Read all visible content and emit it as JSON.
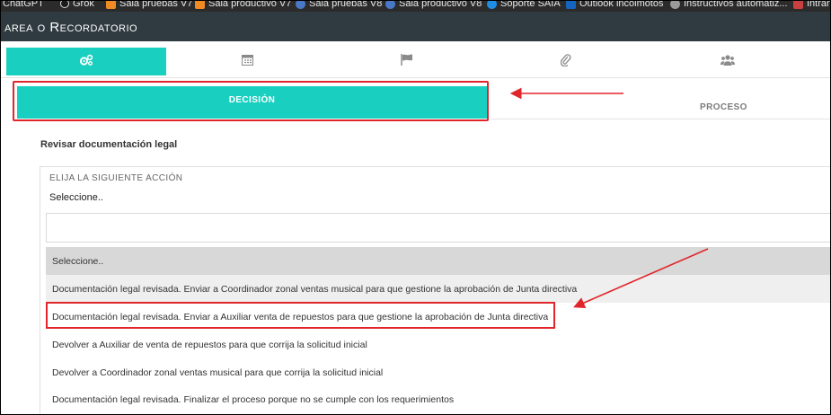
{
  "bookmarks": [
    {
      "label": "ChatGPT",
      "icon": "chatgpt-icon",
      "color": "#1b1b1b"
    },
    {
      "label": "Grok",
      "icon": "grok-icon",
      "color": "#1b1b1b"
    },
    {
      "label": "Sala pruebas V7",
      "icon": "sala-icon",
      "color": "#f08a24"
    },
    {
      "label": "Sala productivo V7",
      "icon": "sala-icon",
      "color": "#f08a24"
    },
    {
      "label": "Sala pruebas V8",
      "icon": "shield-icon",
      "color": "#4a78c9"
    },
    {
      "label": "Sala productivo V8",
      "icon": "shield-icon",
      "color": "#4a78c9"
    },
    {
      "label": "Soporte SAIA",
      "icon": "skype-icon",
      "color": "#1f8de6"
    },
    {
      "label": "Outlook incolmotos",
      "icon": "outlook-icon",
      "color": "#1565c0"
    },
    {
      "label": "Instructivos automatiz...",
      "icon": "wordpress-icon",
      "color": "#777777"
    },
    {
      "label": "Intran",
      "icon": "intranet-icon",
      "color": "#c94040"
    }
  ],
  "window": {
    "title": "area o Recordatorio"
  },
  "icon_tabs": [
    {
      "icon": "gears-icon",
      "glyph": "⚙",
      "active": true
    },
    {
      "icon": "calendar-icon",
      "glyph": "▦",
      "active": false
    },
    {
      "icon": "flag-icon",
      "glyph": "⚑",
      "active": false
    },
    {
      "icon": "paperclip-icon",
      "glyph": "✎",
      "active": false
    },
    {
      "icon": "users-icon",
      "glyph": "👥",
      "active": false
    }
  ],
  "sub_tabs": {
    "decision": "DECISIÓN",
    "proceso": "PROCESO"
  },
  "section_title": "Revisar documentación legal",
  "select": {
    "label": "ELIJA LA SIGUIENTE ACCIÓN",
    "value": "Seleccione..",
    "search_value": ""
  },
  "options": [
    "Seleccione..",
    "Documentación legal revisada. Enviar a Coordinador zonal ventas musical para que gestione la aprobación de Junta directiva",
    "Documentación legal revisada. Enviar a Auxiliar venta de repuestos para que gestione la aprobación de Junta directiva",
    "Devolver a Auxiliar de venta de repuestos para que corrija la solicitud inicial",
    "Devolver a Coordinador zonal ventas musical para que corrija la solicitud inicial",
    "Documentación legal revisada. Finalizar el proceso porque no se cumple con los requerimientos"
  ],
  "colors": {
    "accent": "#19cfbf",
    "annotation": "#e0262b",
    "titlebar": "#2f3b40"
  }
}
